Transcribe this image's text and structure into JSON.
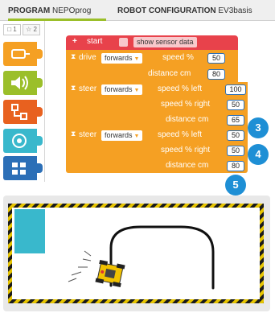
{
  "tabs": {
    "program_label": "PROGRAM",
    "program_name": "NEPOprog",
    "config_label": "ROBOT CONFIGURATION",
    "config_name": "EV3basis"
  },
  "sidebar": {
    "tab_1": "□ 1",
    "tab_2": "☆ 2",
    "categories": [
      {
        "icon": "motor-icon",
        "color": "#f5a023"
      },
      {
        "icon": "sound-icon",
        "color": "#9bbf2a"
      },
      {
        "icon": "control-icon",
        "color": "#e8611f"
      },
      {
        "icon": "sensor-icon",
        "color": "#39b8cc"
      },
      {
        "icon": "logic-icon",
        "color": "#2c6fb7"
      }
    ]
  },
  "program": {
    "start": {
      "plus": "+",
      "label": "start",
      "show_sensor_data": "show sensor data"
    },
    "drive": {
      "label": "drive",
      "direction": "forwards",
      "speed_label": "speed %",
      "speed": "50",
      "distance_label": "distance cm",
      "distance": "80"
    },
    "steer1": {
      "label": "steer",
      "direction": "forwards",
      "speed_left_label": "speed %  left",
      "speed_left": "100",
      "speed_right_label": "speed %  right",
      "speed_right": "50",
      "distance_label": "distance cm",
      "distance": "65"
    },
    "steer2": {
      "label": "steer",
      "direction": "forwards",
      "speed_left_label": "speed %  left",
      "speed_left": "50",
      "speed_right_label": "speed %  right",
      "speed_right": "50",
      "distance_label": "distance cm",
      "distance": "80"
    }
  },
  "badges": [
    "3",
    "4",
    "5"
  ],
  "colors": {
    "accent_green": "#9bbf2a",
    "block_orange": "#f5a023",
    "start_red": "#e8424b",
    "number_blue": "#2c6fb7",
    "badge_blue": "#1e8fd5",
    "start_area_cyan": "#39b8cc",
    "board_border": "#c2a400"
  }
}
